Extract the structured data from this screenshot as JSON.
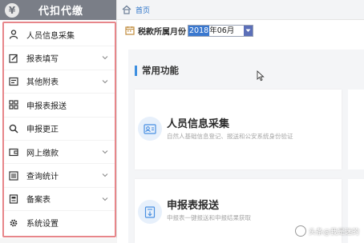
{
  "sidebar": {
    "logo_glyph": "¥",
    "title": "代扣代缴",
    "items": [
      {
        "label": "人员信息采集",
        "icon": "person-icon",
        "has_submenu": false
      },
      {
        "label": "报表填写",
        "icon": "edit-icon",
        "has_submenu": true
      },
      {
        "label": "其他附表",
        "icon": "form-icon",
        "has_submenu": true
      },
      {
        "label": "申报表报送",
        "icon": "grid-icon",
        "has_submenu": false
      },
      {
        "label": "申报更正",
        "icon": "search-icon",
        "has_submenu": false
      },
      {
        "label": "网上缴款",
        "icon": "wallet-icon",
        "has_submenu": true
      },
      {
        "label": "查询统计",
        "icon": "list-icon",
        "has_submenu": true
      },
      {
        "label": "备案表",
        "icon": "document-icon",
        "has_submenu": true
      },
      {
        "label": "系统设置",
        "icon": "gear-icon",
        "has_submenu": false
      }
    ]
  },
  "header": {
    "breadcrumb": "首页"
  },
  "filter": {
    "label": "税款所属月份",
    "month_highlighted": "2018",
    "month_rest": "年06月"
  },
  "main": {
    "section_title": "常用功能",
    "cards": [
      {
        "title": "人员信息采集",
        "desc": "自然人基础信息登记、报送和公安系统身份验证"
      },
      {
        "title": "申报表报送",
        "desc": "申报表一键报送和申报结果获取"
      }
    ]
  },
  "watermark": {
    "text": "头条@我是迷的"
  },
  "colors": {
    "highlight_border": "#e7868a",
    "accent": "#3d8fe0",
    "logo_bar": "#7a7e87"
  }
}
